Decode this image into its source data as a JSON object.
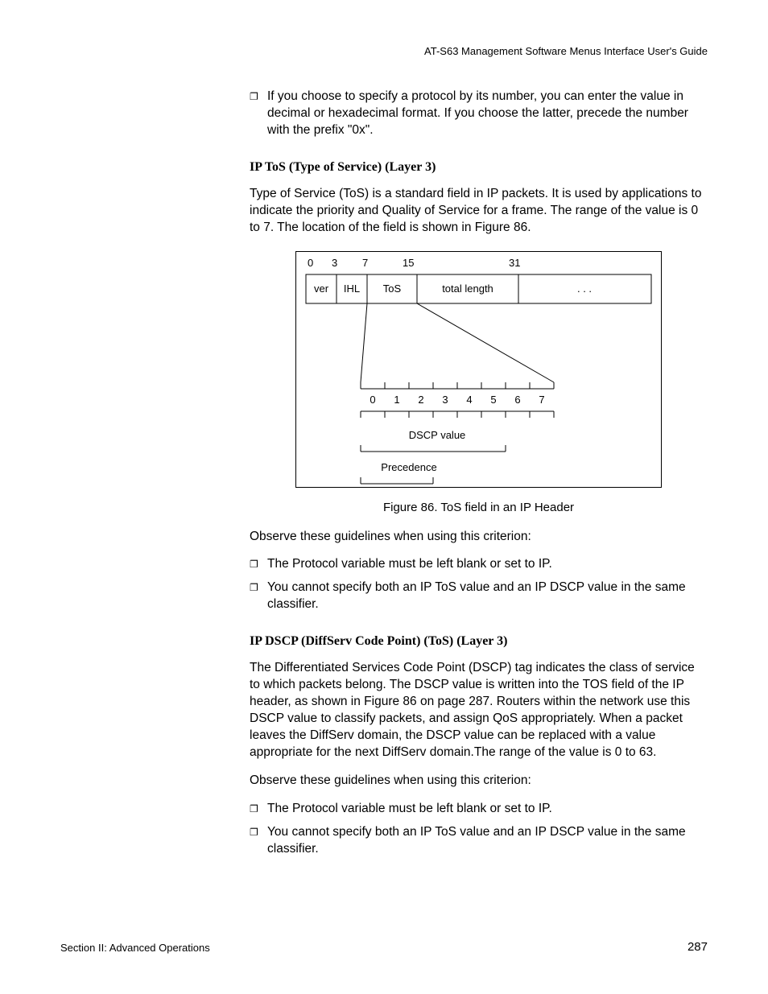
{
  "header": "AT-S63 Management Software Menus Interface User's Guide",
  "intro_bullet": "If you choose to specify a protocol by its number, you can enter the value in decimal or hexadecimal format. If you choose the latter, precede the number with the prefix \"0x\".",
  "heading1": "IP ToS (Type of Service) (Layer 3)",
  "para1": "Type of Service (ToS) is a standard field in IP packets. It is used by applications to indicate the priority and Quality of Service for a frame. The range of the value is 0 to 7. The location of the field is shown in Figure 86.",
  "figure": {
    "top_labels": [
      "0",
      "3",
      "7",
      "15",
      "31"
    ],
    "row_cells": [
      "ver",
      "IHL",
      "ToS",
      "total length",
      ". . ."
    ],
    "bit_labels": [
      "0",
      "1",
      "2",
      "3",
      "4",
      "5",
      "6",
      "7"
    ],
    "dscp_label": "DSCP value",
    "precedence_label": "Precedence",
    "caption": "Figure 86. ToS field in an IP Header"
  },
  "para2": "Observe these guidelines when using this criterion:",
  "bullets1": [
    "The Protocol variable must be left blank or set to IP.",
    "You cannot specify both an IP ToS value and an IP DSCP value in the same classifier."
  ],
  "heading2": "IP DSCP (DiffServ Code Point) (ToS) (Layer 3)",
  "para3": "The Differentiated Services Code Point (DSCP) tag indicates the class of service to which packets belong. The DSCP value is written into the TOS field of the IP header, as shown in Figure 86 on page 287. Routers within the network use this DSCP value to classify packets, and assign QoS appropriately. When a packet leaves the DiffServ domain, the DSCP value can be replaced with a value appropriate for the next DiffServ domain.The range of the value is 0 to 63.",
  "para4": "Observe these guidelines when using this criterion:",
  "bullets2": [
    "The Protocol variable must be left blank or set to IP.",
    "You cannot specify both an IP ToS value and an IP DSCP value in the same classifier."
  ],
  "footer_left": "Section II: Advanced Operations",
  "footer_right": "287"
}
